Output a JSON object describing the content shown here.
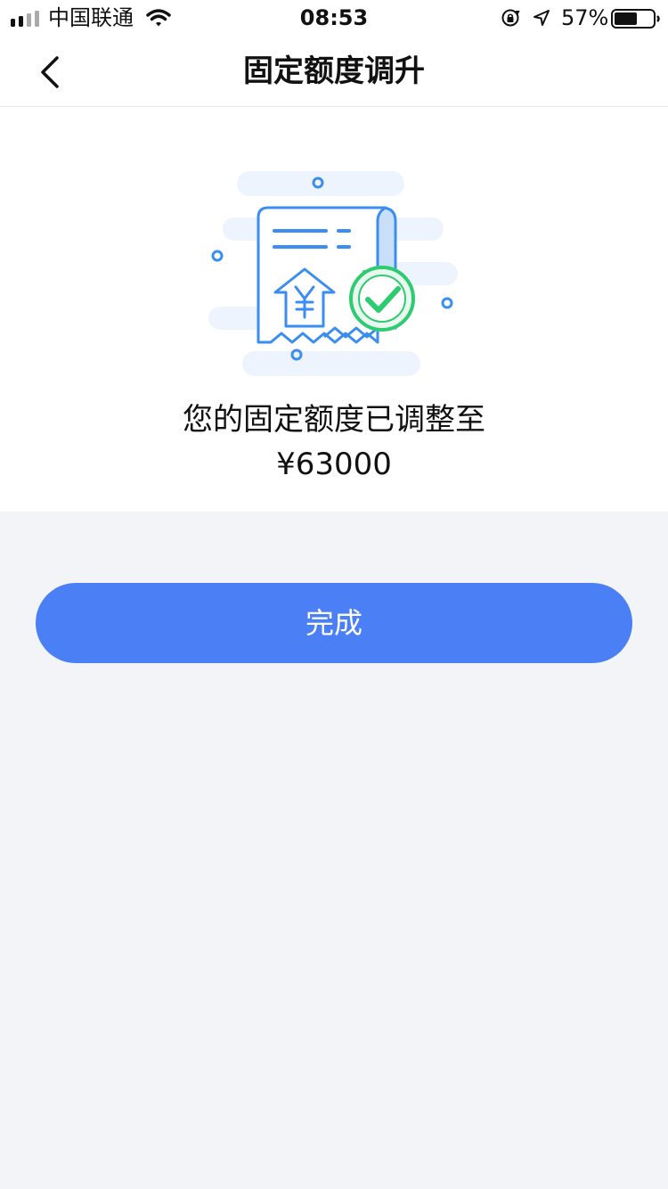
{
  "status_bar": {
    "carrier": "中国联通",
    "time": "08:53",
    "battery_percent": "57%"
  },
  "nav": {
    "title": "固定额度调升"
  },
  "result": {
    "message": "您的固定额度已调整至",
    "amount": "¥63000"
  },
  "actions": {
    "done_label": "完成"
  },
  "colors": {
    "accent": "#4b7ff5",
    "success": "#2ecc71",
    "illustration_blue": "#3a8ef0",
    "page_background": "#f2f4f8"
  },
  "icons": {
    "back": "chevron-left-icon",
    "illustration": "receipt-check-illustration"
  }
}
